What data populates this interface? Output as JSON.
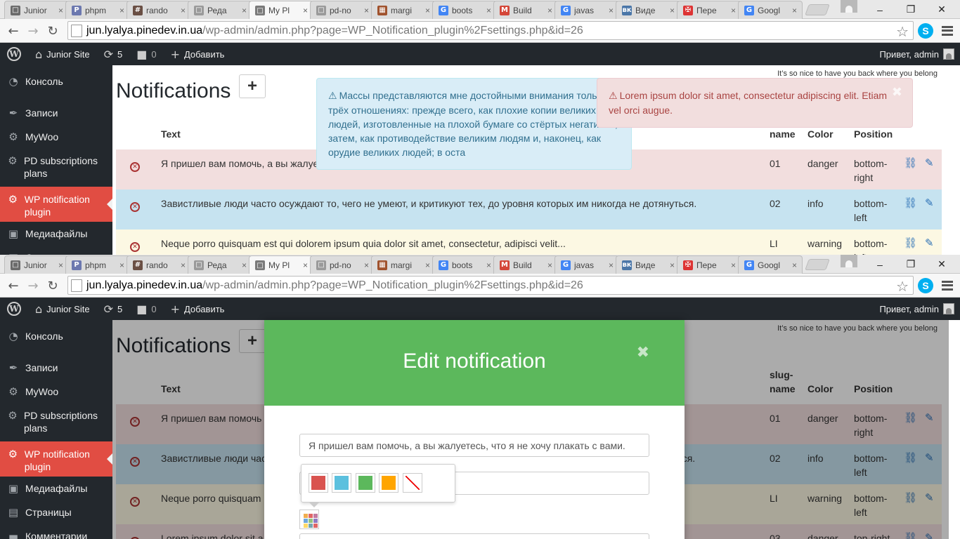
{
  "browser": {
    "tabs": [
      {
        "label": "Junior",
        "fav_color": "#6b6b6b",
        "fav_glyph": "□"
      },
      {
        "label": "phpm",
        "fav_color": "#6c78af",
        "fav_glyph": "P"
      },
      {
        "label": "rando",
        "fav_color": "#6a4f44",
        "fav_glyph": "#"
      },
      {
        "label": "Реда",
        "fav_color": "#9a9a9a",
        "fav_glyph": "□"
      },
      {
        "label": "My Pl",
        "fav_color": "#7a7a7a",
        "fav_glyph": "□",
        "active": true
      },
      {
        "label": "pd-no",
        "fav_color": "#9a9a9a",
        "fav_glyph": "□"
      },
      {
        "label": "margi",
        "fav_color": "#a0522d",
        "fav_glyph": "▦"
      },
      {
        "label": "boots",
        "fav_color": "#4285f4",
        "fav_glyph": "G"
      },
      {
        "label": "Build",
        "fav_color": "#d44638",
        "fav_glyph": "M"
      },
      {
        "label": "javas",
        "fav_color": "#4285f4",
        "fav_glyph": "G"
      },
      {
        "label": "Виде",
        "fav_color": "#4a76a8",
        "fav_glyph": "вк"
      },
      {
        "label": "Пере",
        "fav_color": "#d33",
        "fav_glyph": "✠"
      },
      {
        "label": "Googl",
        "fav_color": "#4285f4",
        "fav_glyph": "G"
      }
    ],
    "url_host": "jun.lyalya.pinedev.in.ua",
    "url_path": "/wp-admin/admin.php?page=WP_Notification_plugin%2Fsettings.php&id=26"
  },
  "adminbar": {
    "site_name": "Junior Site",
    "updates_count": "5",
    "comments_count": "0",
    "add_new": "Добавить",
    "greeting": "Привет, admin"
  },
  "sidebar": {
    "items": [
      {
        "label": "Консоль",
        "icon": "dashboard-icon",
        "glyph": "◔"
      },
      {
        "label": "Записи",
        "icon": "pin-icon",
        "glyph": "✒"
      },
      {
        "label": "MyWoo",
        "icon": "gear-icon",
        "glyph": "⚙"
      },
      {
        "label": "PD subscriptions plans",
        "icon": "gear-icon",
        "glyph": "⚙"
      },
      {
        "label": "WP notification plugin",
        "icon": "gear-icon",
        "glyph": "⚙",
        "current": true
      },
      {
        "label": "Медиафайлы",
        "icon": "media-icon",
        "glyph": "▣"
      },
      {
        "label": "Страницы",
        "icon": "pages-icon",
        "glyph": "▤"
      },
      {
        "label": "Комментарии",
        "icon": "comments-icon",
        "glyph": "▬"
      }
    ]
  },
  "page": {
    "motto": "It’s so nice to have you back where you belong",
    "title": "Notifications",
    "add_button": "+",
    "columns": {
      "text": "Text",
      "slug": "slug-name",
      "slug_short": "name",
      "color": "Color",
      "position": "Position"
    },
    "rows": [
      {
        "text": "Я пришел вам помочь, а вы жалуетесь, что я не хочу плакать с вами.",
        "text_short": "Я пришел вам помочь, а вы жалуе",
        "text_modal": "Я пришел вам помочь",
        "slug": "01",
        "color": "danger",
        "position": "bottom-\nright"
      },
      {
        "text": "Завистливые люди часто осуждают то, чего не умеют, и критикуют тех, до уровня которых им никогда не дотянуться.",
        "text_modal": "Завистливые люди час",
        "text_tail": "ться.",
        "slug": "02",
        "color": "info",
        "position": "bottom-\nleft"
      },
      {
        "text": "Neque porro quisquam est qui dolorem ipsum quia dolor sit amet, consectetur, adipisci velit...",
        "text_modal": "Neque porro quisquam",
        "slug": "LI",
        "color": "warning",
        "position": "bottom-\nleft"
      },
      {
        "text_modal": "Lorem ipsum dolor sit a",
        "slug": "03",
        "color": "danger",
        "position": "top-right"
      }
    ]
  },
  "notifications": {
    "info": "Массы представляются мне достойными внимания только в трёх отношениях: прежде всего, как плохие копии великих людей, изготовленные на плохой бумаге со стёртых негативов, затем, как противодействие великим людям и, наконец, как орудие великих людей; в оста",
    "danger": "Lorem ipsum dolor sit amet, consectetur adipiscing elit. Etiam vel orci augue."
  },
  "modal": {
    "title": "Edit notification",
    "close": "✖",
    "text_value": "Я пришел вам помочь, а вы жалуетесь, что я не хочу плакать с вами.",
    "swatches": [
      "#d9534f",
      "#5bc0de",
      "#5cb85c",
      "#ffa500",
      "none"
    ],
    "picker_colors": [
      "#f0ad4e",
      "#e06666",
      "#c27ba0",
      "#6fa8dc",
      "#93c47d",
      "#8e7cc3",
      "#ffd966",
      "#76a5af",
      "#e06666"
    ]
  },
  "colors": {
    "admin_bar": "#23282d",
    "current_menu": "#e14d43",
    "modal_header": "#5cb85c"
  }
}
